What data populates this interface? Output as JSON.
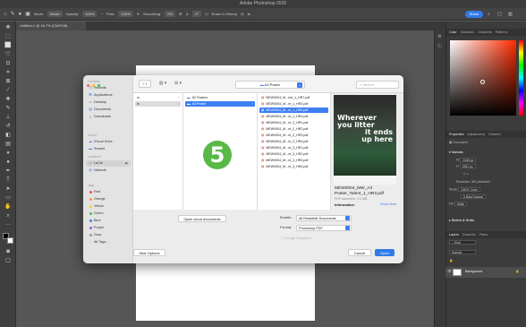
{
  "app": {
    "window_title": "Adobe Photoshop 2026",
    "doc_tab": "Untitled-1 @ 16.7% (CMYK/8)"
  },
  "options_bar": {
    "mode_label": "Mode:",
    "mode_value": "Brush",
    "opacity_label": "Opacity:",
    "opacity_value": "100%",
    "flow_label": "Flow:",
    "flow_value": "100%",
    "smoothing_label": "Smoothing:",
    "smoothing_value": "0%",
    "angle_value": "0°",
    "erase_history": "Erase to History",
    "share_label": "Share"
  },
  "right_panel": {
    "color_tabs": [
      "Color",
      "Swatches",
      "Gradients",
      "Patterns"
    ],
    "props_tabs": [
      "Properties",
      "Adjustments",
      "Libraries"
    ],
    "document_label": "Document",
    "canvas_label": "Canvas",
    "w_label": "W",
    "w_value": "2048 px",
    "h_label": "H",
    "h_value": "4961 px",
    "resolution": "Resolution: 300 pixels/inch",
    "mode_label": "Mode",
    "mode_value": "CMYK Color",
    "bits_value": "8 Bits/Channel",
    "fill_label": "Fill",
    "fill_value": "White",
    "rulers_label": "Rulers & Grids",
    "layers_tabs": [
      "Layers",
      "Channels",
      "Paths"
    ],
    "layer_name": "Background"
  },
  "dialog": {
    "sidebar": {
      "favorites_head": "Favorites",
      "favorites": [
        {
          "icon": "clock-icon",
          "label": "Recents"
        },
        {
          "icon": "apps-icon",
          "label": "Applications"
        },
        {
          "icon": "desktop-icon",
          "label": "Desktop"
        },
        {
          "icon": "doc-icon",
          "label": "Documents"
        },
        {
          "icon": "download-icon",
          "label": "Downloads"
        }
      ],
      "icloud_head": "iCloud",
      "icloud": [
        {
          "icon": "cloud-icon",
          "label": "iCloud Drive"
        },
        {
          "icon": "folder-icon",
          "label": "Shared"
        }
      ],
      "locations_head": "Locations",
      "locations": [
        {
          "icon": "laptop-icon",
          "label": "LaCie",
          "selected": true
        },
        {
          "icon": "globe-icon",
          "label": "Network"
        }
      ],
      "tags_head": "Tags",
      "tags": [
        {
          "label": "Red",
          "color": "#ff4b4b"
        },
        {
          "label": "Orange",
          "color": "#ff9a2e"
        },
        {
          "label": "Yellow",
          "color": "#f7d02c"
        },
        {
          "label": "Green",
          "color": "#3fc45a"
        },
        {
          "label": "Blue",
          "color": "#3d7ef3"
        },
        {
          "label": "Purple",
          "color": "#a35ee0"
        },
        {
          "label": "Gray",
          "color": "#9a9a9a"
        },
        {
          "label": "All Tags...",
          "color": ""
        }
      ]
    },
    "path_value": "A3 Poster",
    "search_placeholder": "Search",
    "col1": [
      "rs",
      "ts"
    ],
    "col2": [
      {
        "label": "A2 Posters",
        "selected": false
      },
      {
        "label": "A3 Poster",
        "selected": true
      }
    ],
    "files": [
      "MEW0004_M...ent_1_HR7.pdf",
      "MEW0004_M...nt_1_HR2.pdf",
      "MEW0004_M...nt_1_HR3.pdf",
      "MEW0004_M...nt_1_HR4.pdf",
      "MEW0004_M...nt_2_HR1.pdf",
      "MEW0004_M...nt_2_HR2.pdf",
      "MEW0004_M...nt_2_HR3.pdf",
      "MEW0004_M...nt_2_HR4.pdf",
      "MEW0004_M...nt_3_HR1.pdf",
      "MEW0004_M...nt_3_HR2.pdf",
      "MEW0004_M...nt_3_HR3.pdf",
      "MEW0004_M...nt_3_HR4.pdf"
    ],
    "selected_file_index": 2,
    "preview": {
      "headline1": "Wherever you litter",
      "headline2": "it ends up here",
      "filename": "MEW0004_MW_A3 Poster_Talent_1_HR3.pdf",
      "kind": "PDF document - 2.1 MB",
      "info_label": "Information",
      "show_more": "Show More"
    },
    "step_number": "5",
    "open_cloud_label": "Open cloud documents",
    "enable_label": "Enable:",
    "enable_value": "All Readable Documents",
    "format_label": "Format:",
    "format_value": "Photoshop PDF",
    "image_sequence": "Image Sequence",
    "hide_options": "Hide Options",
    "cancel": "Cancel",
    "open": "Open"
  }
}
